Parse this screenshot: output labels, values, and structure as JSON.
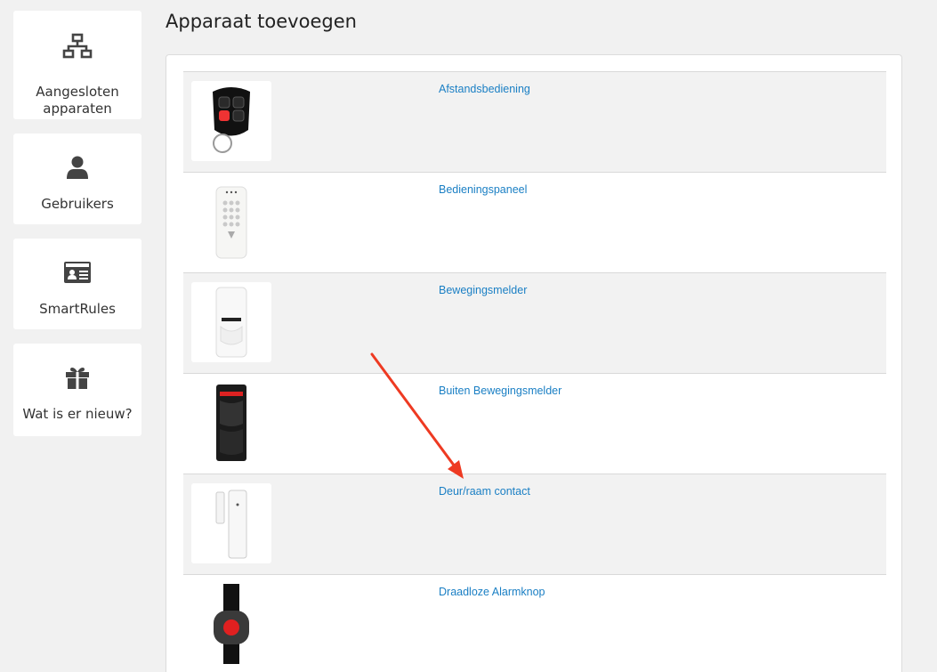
{
  "sidebar": {
    "items": [
      {
        "label": "Aangesloten apparaten",
        "icon": "network-icon"
      },
      {
        "label": "Gebruikers",
        "icon": "user-icon"
      },
      {
        "label": "SmartRules",
        "icon": "id-card-icon"
      },
      {
        "label": "Wat is er nieuw?",
        "icon": "gift-icon"
      }
    ]
  },
  "main": {
    "title": "Apparaat toevoegen",
    "devices": [
      {
        "label": "Afstandsbediening"
      },
      {
        "label": "Bedieningspaneel"
      },
      {
        "label": "Bewegingsmelder"
      },
      {
        "label": "Buiten Bewegingsmelder"
      },
      {
        "label": "Deur/raam contact"
      },
      {
        "label": "Draadloze Alarmknop"
      }
    ]
  },
  "colors": {
    "link": "#1a7fc4",
    "annotation_arrow": "#ee3a22",
    "row_alt": "#f2f2f2"
  }
}
